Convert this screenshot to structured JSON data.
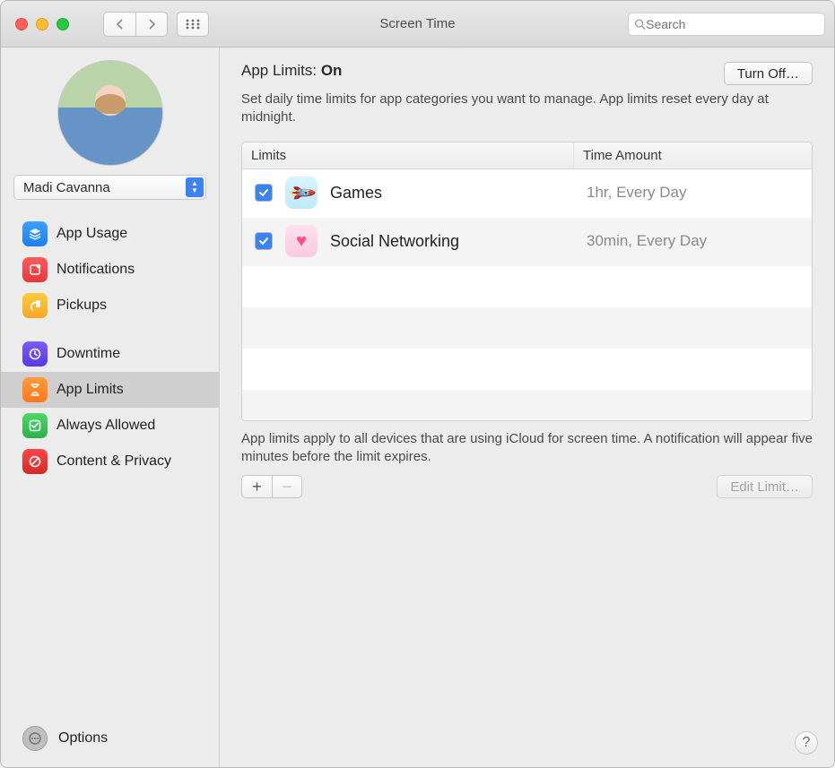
{
  "window": {
    "title": "Screen Time",
    "search_placeholder": "Search"
  },
  "sidebar": {
    "user_name": "Madi Cavanna",
    "groups": [
      {
        "items": [
          {
            "id": "app-usage",
            "label": "App Usage",
            "icon": "layers-icon",
            "color": "ic-blue"
          },
          {
            "id": "notifications",
            "label": "Notifications",
            "icon": "bell-icon",
            "color": "ic-red"
          },
          {
            "id": "pickups",
            "label": "Pickups",
            "icon": "pickup-icon",
            "color": "ic-yellow"
          }
        ]
      },
      {
        "items": [
          {
            "id": "downtime",
            "label": "Downtime",
            "icon": "clock-icon",
            "color": "ic-purple"
          },
          {
            "id": "app-limits",
            "label": "App Limits",
            "icon": "hourglass-icon",
            "color": "ic-orange",
            "selected": true
          },
          {
            "id": "always-allowed",
            "label": "Always Allowed",
            "icon": "check-icon",
            "color": "ic-green"
          },
          {
            "id": "content-privacy",
            "label": "Content & Privacy",
            "icon": "noentry-icon",
            "color": "ic-darkred"
          }
        ]
      }
    ],
    "options_label": "Options"
  },
  "main": {
    "heading_prefix": "App Limits: ",
    "heading_status": "On",
    "turn_off_label": "Turn Off…",
    "description": "Set daily time limits for app categories you want to manage. App limits reset every day at midnight.",
    "columns": {
      "limits": "Limits",
      "time": "Time Amount"
    },
    "rows": [
      {
        "enabled": true,
        "icon": "rocket-icon",
        "icon_class": "games",
        "name": "Games",
        "time": "1hr, Every Day"
      },
      {
        "enabled": true,
        "icon": "heart-bubble-icon",
        "icon_class": "social",
        "name": "Social Networking",
        "time": "30min, Every Day"
      }
    ],
    "footnote": "App limits apply to all devices that are using iCloud for screen time. A notification will appear five minutes before the limit expires.",
    "add_label": "+",
    "remove_label": "−",
    "edit_label": "Edit Limit…"
  }
}
